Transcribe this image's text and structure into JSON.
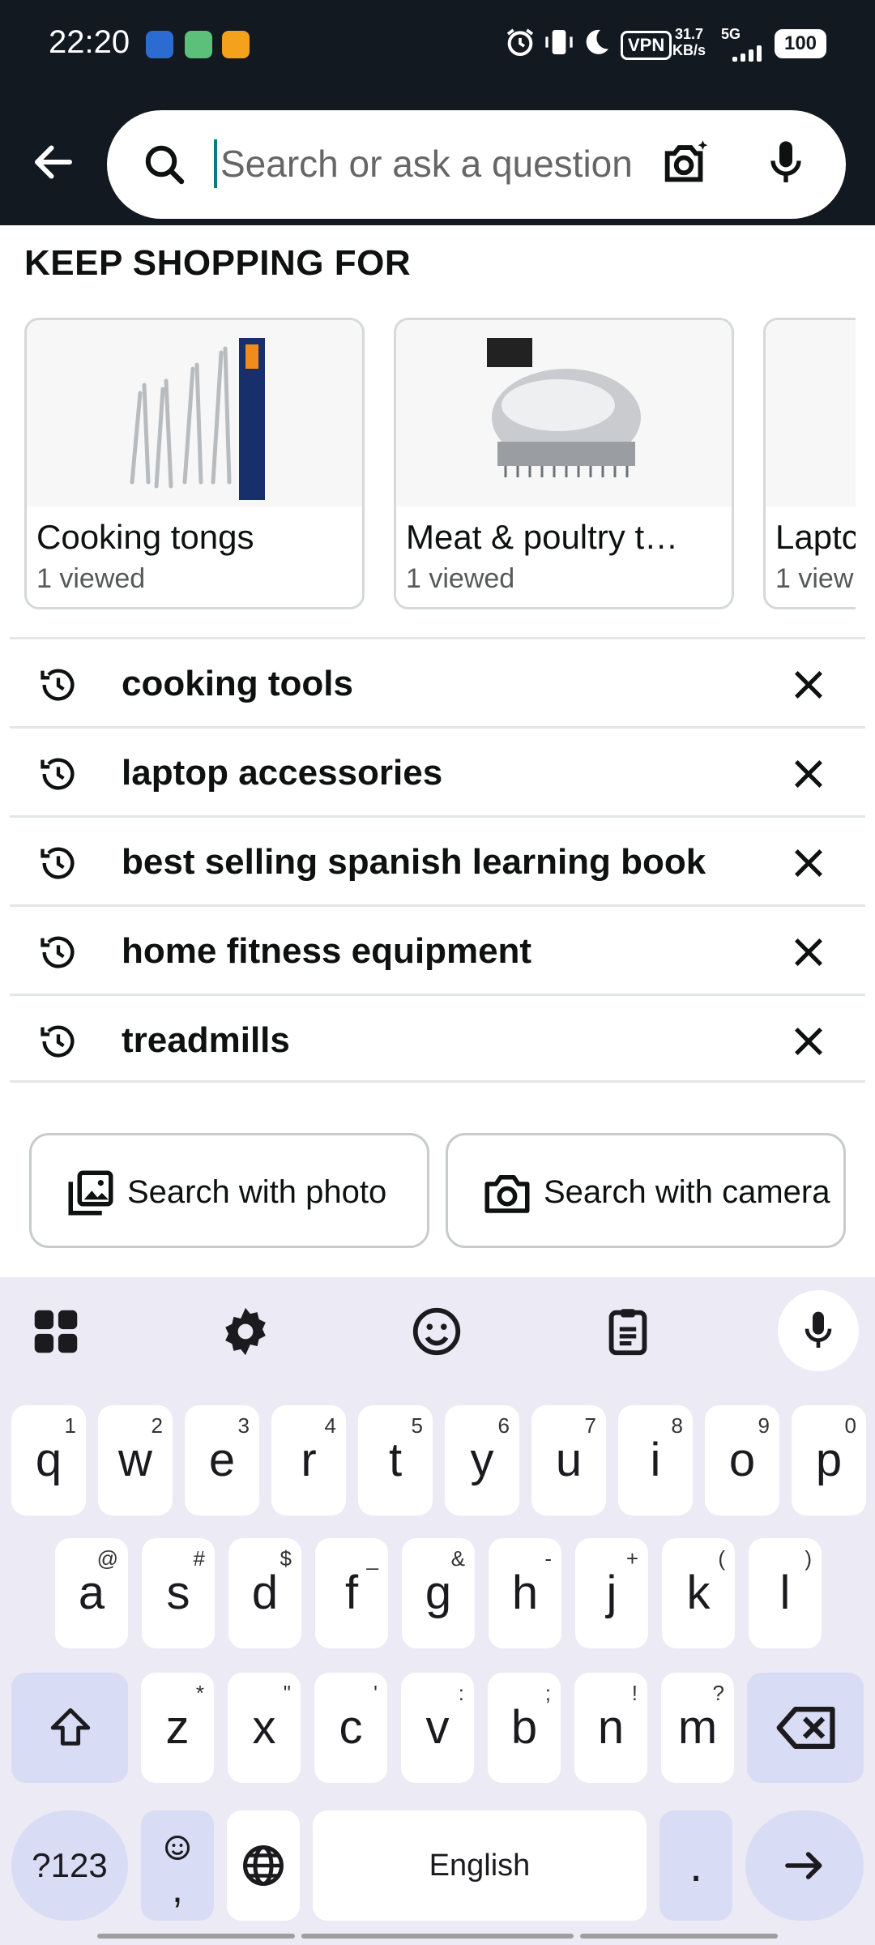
{
  "status": {
    "time": "22:20",
    "vpn": "VPN",
    "speed_top": "31.7",
    "speed_bottom": "KB/s",
    "network": "5G",
    "battery": "100"
  },
  "search": {
    "placeholder": "Search or ask a question"
  },
  "keep_shopping": {
    "title": "KEEP SHOPPING FOR",
    "cards": [
      {
        "name": "Cooking tongs",
        "sub": "1 viewed"
      },
      {
        "name": "Meat & poultry t…",
        "sub": "1 viewed"
      },
      {
        "name": "Laptc",
        "sub": "1 view"
      }
    ]
  },
  "history": [
    "cooking tools",
    "laptop accessories",
    "best selling spanish learning book",
    "home fitness equipment",
    "treadmills"
  ],
  "buttons": {
    "photo": "Search with photo",
    "camera": "Search with camera"
  },
  "keyboard": {
    "row1": [
      [
        "q",
        "1"
      ],
      [
        "w",
        "2"
      ],
      [
        "e",
        "3"
      ],
      [
        "r",
        "4"
      ],
      [
        "t",
        "5"
      ],
      [
        "y",
        "6"
      ],
      [
        "u",
        "7"
      ],
      [
        "i",
        "8"
      ],
      [
        "o",
        "9"
      ],
      [
        "p",
        "0"
      ]
    ],
    "row2": [
      [
        "a",
        "@"
      ],
      [
        "s",
        "#"
      ],
      [
        "d",
        "$"
      ],
      [
        "f",
        "_"
      ],
      [
        "g",
        "&"
      ],
      [
        "h",
        "-"
      ],
      [
        "j",
        "+"
      ],
      [
        "k",
        "("
      ],
      [
        "l",
        ")"
      ]
    ],
    "row3": [
      [
        "z",
        "*"
      ],
      [
        "x",
        "\""
      ],
      [
        "c",
        "'"
      ],
      [
        "v",
        ":"
      ],
      [
        "b",
        ";"
      ],
      [
        "n",
        "!"
      ],
      [
        "m",
        "?"
      ]
    ],
    "symbols": "?123",
    "comma": ",",
    "space": "English",
    "period": "."
  },
  "colors": {
    "header_bg": "#131921",
    "accent": "#0a7b83"
  }
}
